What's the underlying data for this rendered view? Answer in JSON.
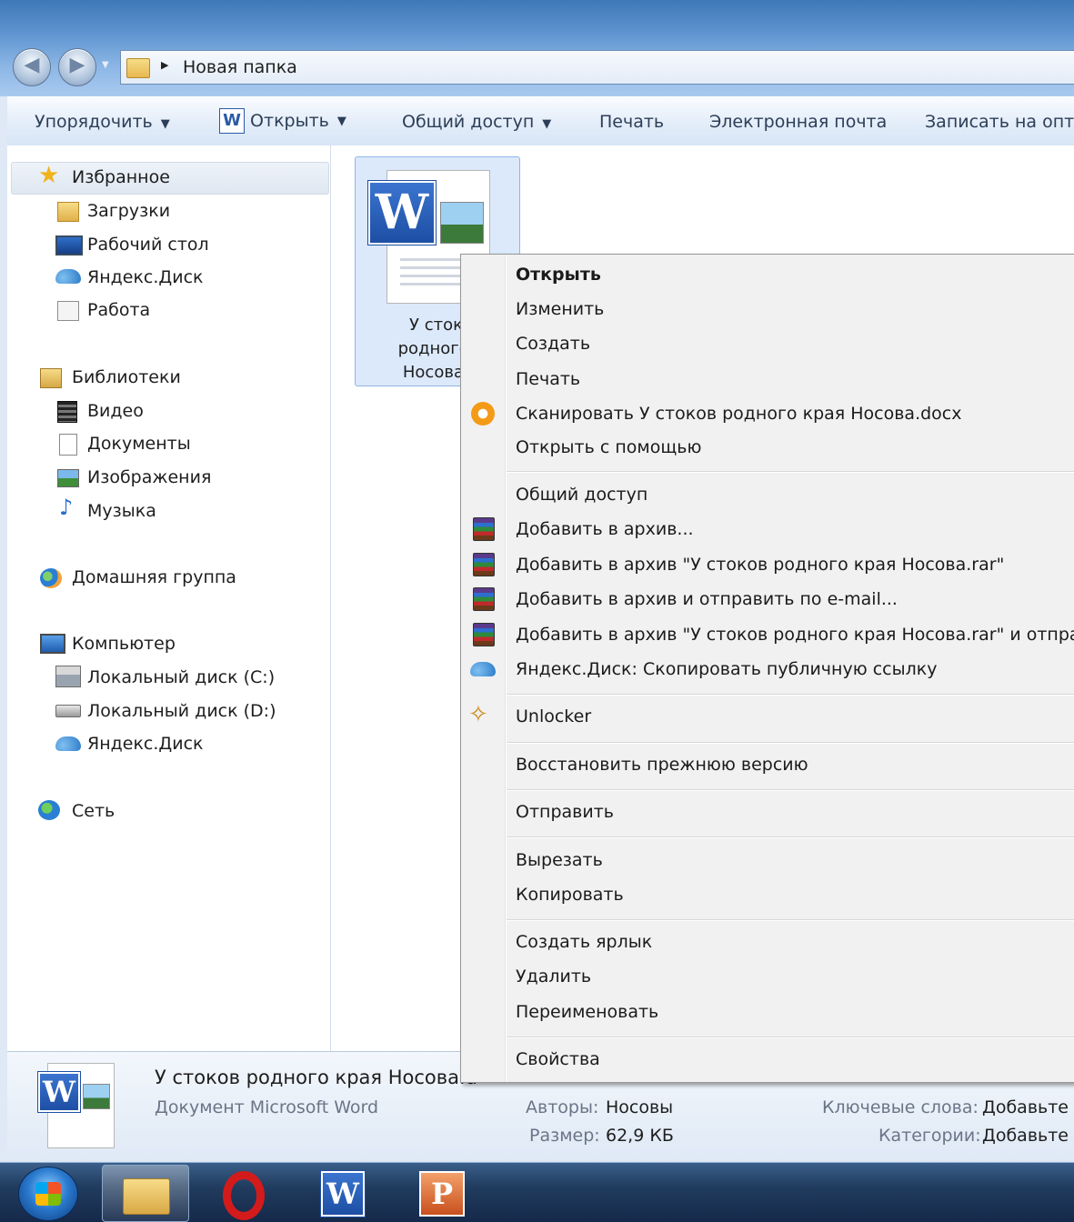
{
  "window": {
    "breadcrumb": "Новая папка"
  },
  "toolbar": {
    "organize": "Упорядочить",
    "open": "Открыть",
    "share": "Общий доступ",
    "print": "Печать",
    "email": "Электронная почта",
    "burn": "Записать на опти"
  },
  "nav": {
    "favorites": "Избранное",
    "downloads": "Загрузки",
    "desktop": "Рабочий стол",
    "yandex_disk": "Яндекс.Диск",
    "work": "Работа",
    "libraries": "Библиотеки",
    "video": "Видео",
    "documents": "Документы",
    "pictures": "Изображения",
    "music": "Музыка",
    "homegroup": "Домашняя группа",
    "computer": "Компьютер",
    "disk_c": "Локальный диск (C:)",
    "disk_d": "Локальный диск (D:)",
    "yandex_disk2": "Яндекс.Диск",
    "network": "Сеть"
  },
  "file": {
    "caption_line1": "У стоко",
    "caption_line2": "родного к",
    "caption_line3": "Носова.d"
  },
  "context_menu": {
    "open": "Открыть",
    "edit": "Изменить",
    "new": "Создать",
    "print": "Печать",
    "scan": "Сканировать У стоков родного края Носова.docx",
    "open_with": "Открыть с помощью",
    "share": "Общий доступ",
    "add_archive": "Добавить в архив...",
    "add_archive_rar": "Добавить в архив \"У стоков родного края Носова.rar\"",
    "add_archive_email": "Добавить в архив и отправить по e-mail...",
    "add_archive_rar_email": "Добавить в архив \"У стоков родного края Носова.rar\" и отправит",
    "yandex_copy_link": "Яндекс.Диск: Скопировать публичную ссылку",
    "unlocker": "Unlocker",
    "restore": "Восстановить прежнюю версию",
    "send_to": "Отправить",
    "cut": "Вырезать",
    "copy": "Копировать",
    "shortcut": "Создать ярлык",
    "delete": "Удалить",
    "rename": "Переименовать",
    "properties": "Свойства"
  },
  "details": {
    "filename": "У стоков родного края Носова.d",
    "filetype": "Документ Microsoft Word",
    "authors_label": "Авторы:",
    "authors_value": "Носовы",
    "size_label": "Размер:",
    "size_value": "62,9 КБ",
    "keywords_label": "Ключевые слова:",
    "keywords_value": "Добавьте к",
    "categories_label": "Категории:",
    "categories_value": "Добавьте к"
  },
  "icons": {
    "favorites": "star-icon",
    "downloads": "downloads-folder-icon",
    "desktop": "desktop-icon",
    "yandex": "yandex-disk-cloud-icon",
    "work": "work-folder-icon",
    "libraries": "libraries-icon",
    "video": "film-icon",
    "documents": "documents-icon",
    "pictures": "pictures-icon",
    "music": "music-note-icon",
    "homegroup": "homegroup-icon",
    "computer": "computer-icon",
    "disk": "hard-disk-icon",
    "network": "network-globe-icon",
    "winrar": "winrar-icon",
    "unlocker": "unlocker-wand-icon",
    "avast": "avast-scan-icon"
  }
}
